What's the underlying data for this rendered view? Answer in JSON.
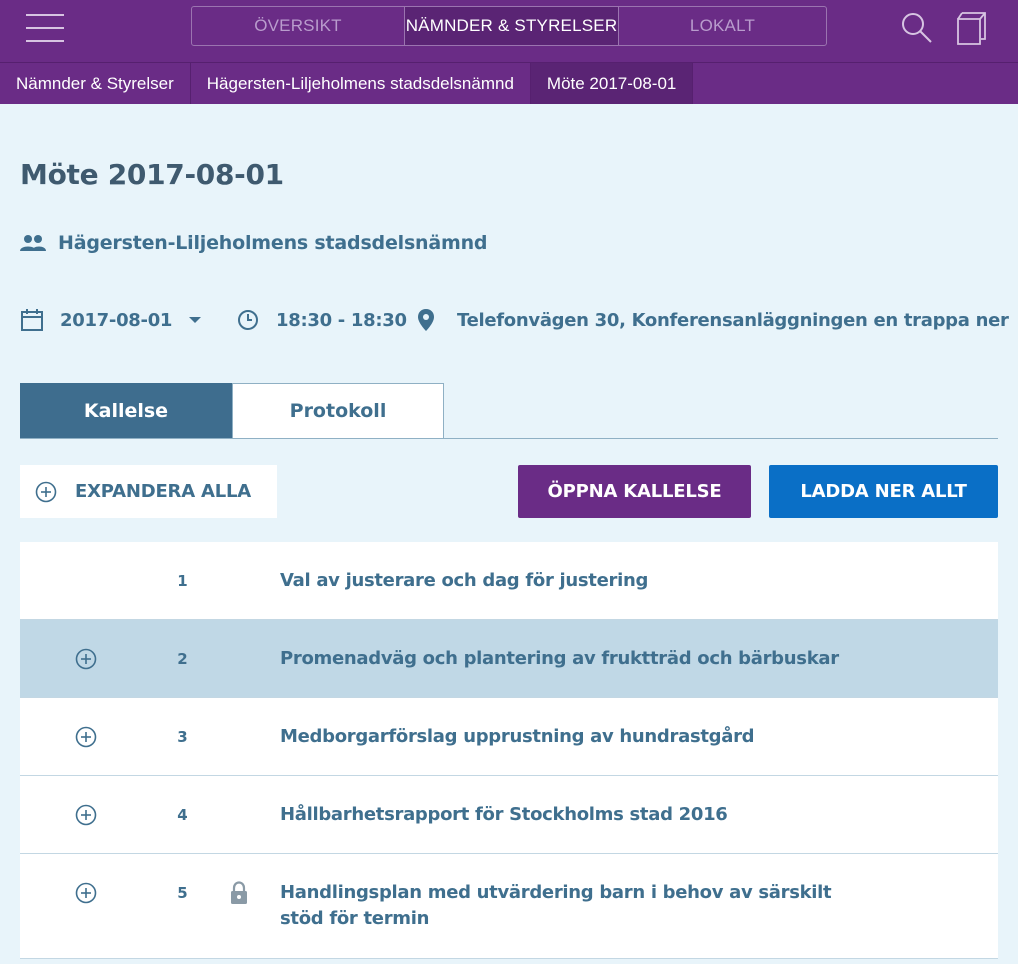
{
  "colors": {
    "brand_purple": "#6a2c86",
    "active_purple": "#5a2474",
    "tab_active": "#3e6d8e",
    "download_blue": "#0a6fc6",
    "row_highlight": "#c0d8e6",
    "background": "#e8f4fa"
  },
  "topbar": {
    "menu_icon": "hamburger-menu-icon",
    "segments": [
      {
        "label": "ÖVERSIKT",
        "selected": false
      },
      {
        "label": "NÄMNDER & STYRELSER",
        "selected": true
      },
      {
        "label": "LOKALT",
        "selected": false
      }
    ],
    "search_icon": "search-icon",
    "copy_icon": "documents-icon"
  },
  "breadcrumb": [
    {
      "label": "Nämnder & Styrelser"
    },
    {
      "label": "Hägersten-Liljeholmens stadsdelsnämnd"
    },
    {
      "label": "Möte 2017-08-01",
      "active": true
    }
  ],
  "meeting": {
    "title": "Möte 2017-08-01",
    "committee": "Hägersten-Liljeholmens stadsdelsnämnd",
    "date": "2017-08-01",
    "time": "18:30 - 18:30",
    "location": "Telefonvägen 30, Konferensanläggningen en trappa ner"
  },
  "tabs": [
    {
      "label": "Kallelse",
      "selected": true
    },
    {
      "label": "Protokoll",
      "selected": false
    }
  ],
  "actions": {
    "expand_all": "EXPANDERA ALLA",
    "open_notice": "ÖPPNA KALLELSE",
    "download_all": "LADDA NER ALLT"
  },
  "agenda": [
    {
      "number": "1",
      "title": "Val av justerare och dag för justering",
      "expandable": false,
      "locked": false
    },
    {
      "number": "2",
      "title": "Promenadväg och plantering av fruktträd och bärbuskar",
      "expandable": true,
      "locked": false,
      "highlighted": true
    },
    {
      "number": "3",
      "title": "Medborgarförslag upprustning av hundrastgård",
      "expandable": true,
      "locked": false
    },
    {
      "number": "4",
      "title": "Hållbarhetsrapport för Stockholms stad 2016",
      "expandable": true,
      "locked": false
    },
    {
      "number": "5",
      "title": "Handlingsplan med utvärdering barn i behov av särskilt stöd för termin",
      "expandable": true,
      "locked": true
    }
  ]
}
